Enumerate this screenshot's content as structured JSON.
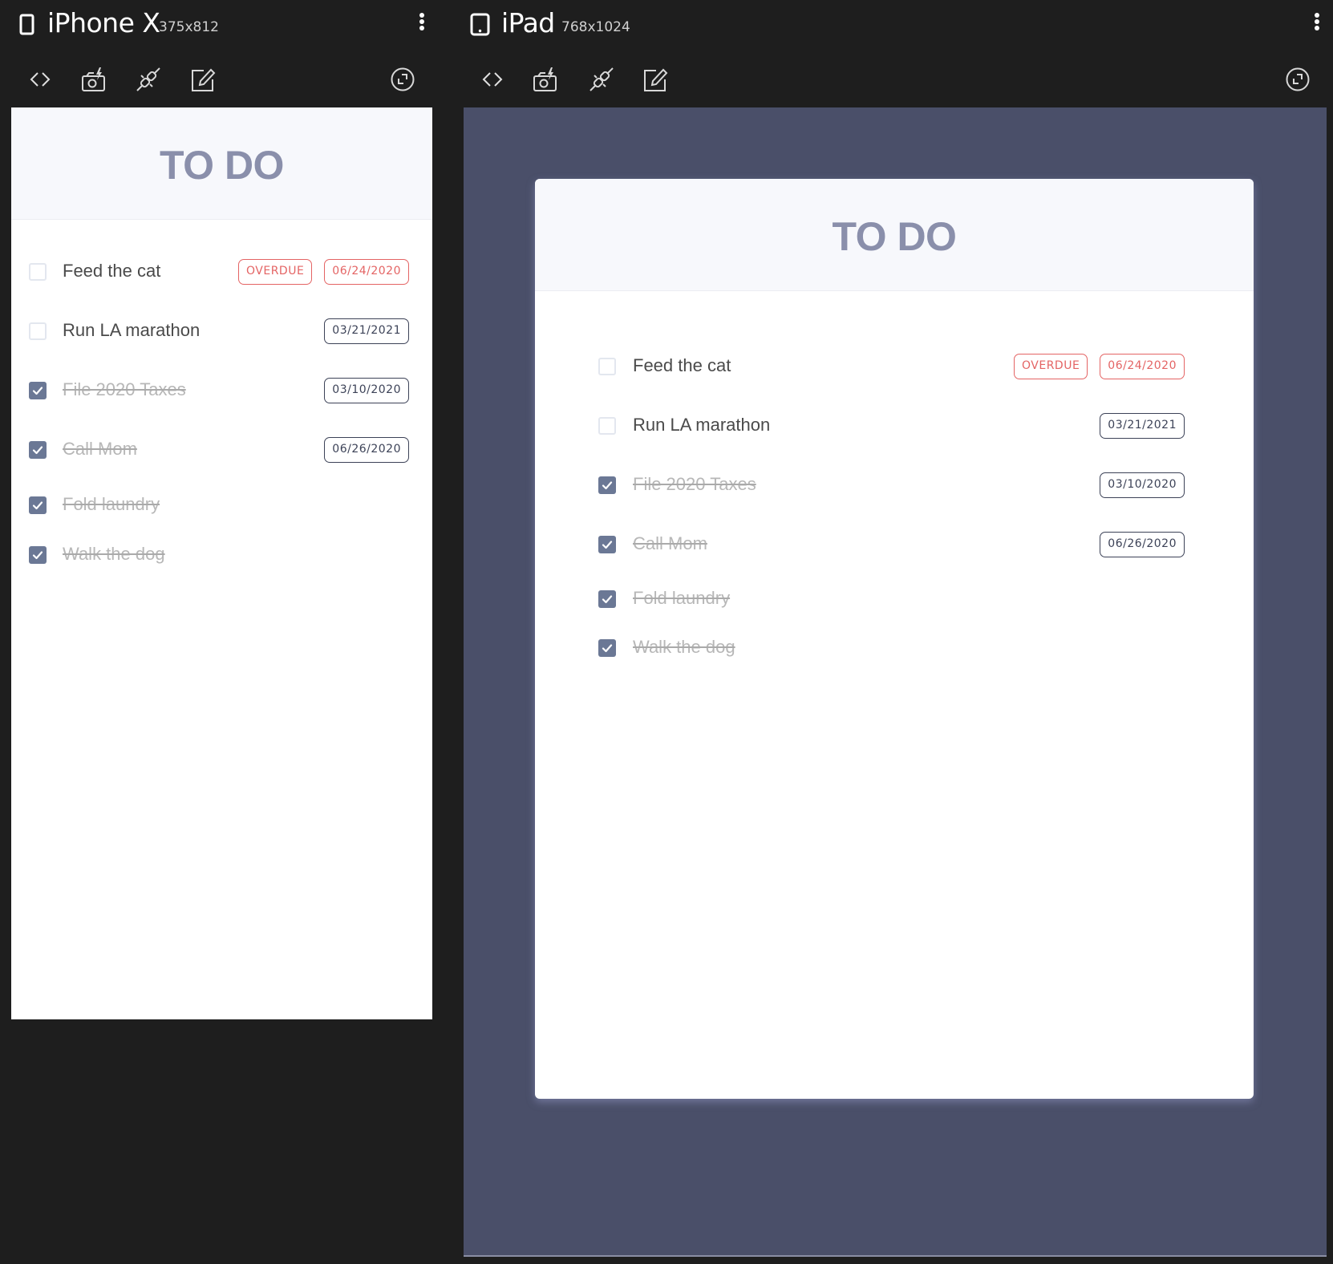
{
  "devices": [
    {
      "name": "iPhone X",
      "size": "375x812",
      "toolbar": [
        "code-view",
        "screenshot",
        "connect",
        "edit",
        "rotate"
      ],
      "app": {
        "title": "TO DO",
        "tasks": [
          {
            "label": "Feed the cat",
            "done": false,
            "overdue_label": "OVERDUE",
            "date": "06/24/2020",
            "overdue": true
          },
          {
            "label": "Run LA marathon",
            "done": false,
            "date": "03/21/2021",
            "overdue": false
          },
          {
            "label": "File 2020 Taxes",
            "done": true,
            "date": "03/10/2020",
            "overdue": false
          },
          {
            "label": "Call Mom",
            "done": true,
            "date": "06/26/2020",
            "overdue": false
          },
          {
            "label": "Fold laundry",
            "done": true,
            "date": null,
            "overdue": false
          },
          {
            "label": "Walk the dog",
            "done": true,
            "date": null,
            "overdue": false
          }
        ]
      }
    },
    {
      "name": "iPad",
      "size": "768x1024",
      "toolbar": [
        "code-view",
        "screenshot",
        "connect",
        "edit",
        "rotate"
      ],
      "app": {
        "title": "TO DO",
        "tasks": [
          {
            "label": "Feed the cat",
            "done": false,
            "overdue_label": "OVERDUE",
            "date": "06/24/2020",
            "overdue": true
          },
          {
            "label": "Run LA marathon",
            "done": false,
            "date": "03/21/2021",
            "overdue": false
          },
          {
            "label": "File 2020 Taxes",
            "done": true,
            "date": "03/10/2020",
            "overdue": false
          },
          {
            "label": "Call Mom",
            "done": true,
            "date": "06/26/2020",
            "overdue": false
          },
          {
            "label": "Fold laundry",
            "done": true,
            "date": null,
            "overdue": false
          },
          {
            "label": "Walk the dog",
            "done": true,
            "date": null,
            "overdue": false
          }
        ]
      }
    }
  ],
  "colors": {
    "chrome_bg": "#1e1e1e",
    "ipad_backdrop": "#4a4f69",
    "title": "#8a8fab",
    "header_bg": "#f7f8fc",
    "checkbox_checked": "#6b7895",
    "overdue": "#e46464",
    "badge": "#3c4257"
  }
}
